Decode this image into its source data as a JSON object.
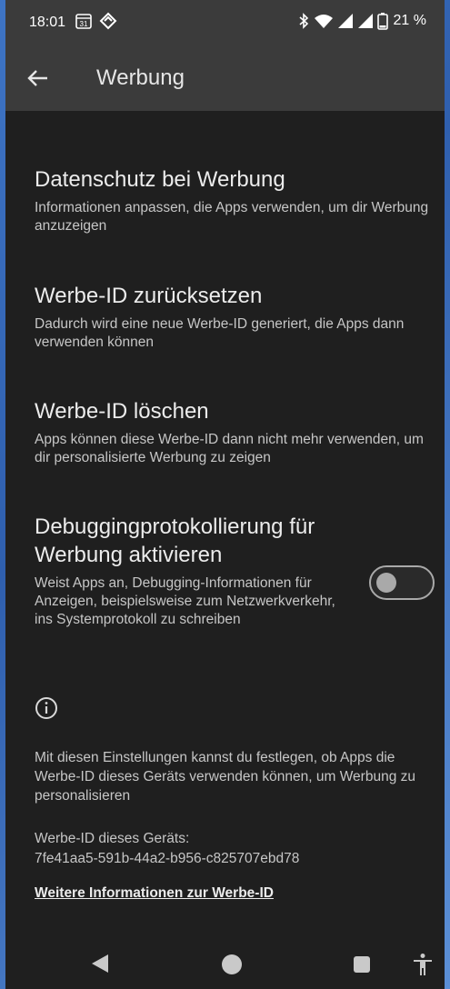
{
  "status_bar": {
    "time": "18:01",
    "calendar_day": "31",
    "battery_percent": "21 %"
  },
  "app_bar": {
    "title": "Werbung"
  },
  "items": [
    {
      "title": "Datenschutz bei Werbung",
      "subtitle": "Informationen anpassen, die Apps verwenden, um dir Werbung anzuzeigen"
    },
    {
      "title": "Werbe-ID zurücksetzen",
      "subtitle": "Dadurch wird eine neue Werbe-ID generiert, die Apps dann verwenden können"
    },
    {
      "title": "Werbe-ID löschen",
      "subtitle": "Apps können diese Werbe-ID dann nicht mehr verwenden, um dir personalisierte Werbung zu zeigen"
    },
    {
      "title": "Debuggingprotokollierung für Werbung aktivieren",
      "subtitle": "Weist Apps an, Debugging-Informationen für Anzeigen, beispielsweise zum Netzwerkverkehr, ins Systemprotokoll zu schreiben",
      "toggle_on": false
    }
  ],
  "info": {
    "text": "Mit diesen Einstellungen kannst du festlegen, ob Apps die Werbe-ID dieses Geräts verwenden können, um Werbung zu personalisieren",
    "device_id_label": "Werbe-ID dieses Geräts:",
    "device_id_value": "7fe41aa5-591b-44a2-b956-c825707ebd78",
    "more_link": "Weitere Informationen zur Werbe-ID"
  },
  "icons": {
    "back": "arrow-back-icon",
    "info": "info-icon",
    "bluetooth": "bluetooth-icon",
    "wifi": "wifi-icon",
    "signal": "signal-icon",
    "battery": "battery-icon"
  },
  "colors": {
    "background": "#1f1f1f",
    "header": "#3b3b3b",
    "text_primary": "#ececec",
    "text_secondary": "#c6c6c6"
  }
}
